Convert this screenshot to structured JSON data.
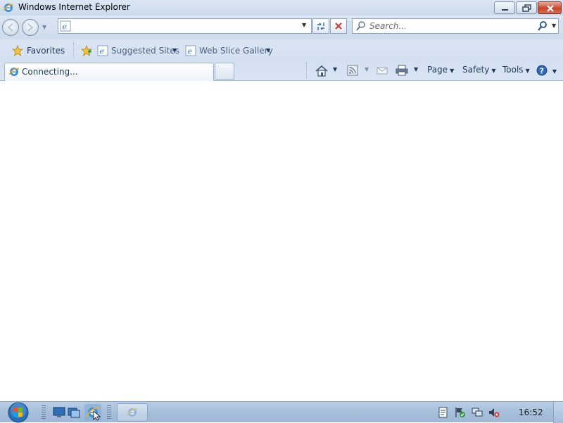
{
  "window": {
    "title": "Windows Internet Explorer",
    "icon": "ie-icon",
    "controls": [
      "minimize-icon",
      "restore-icon",
      "close-icon"
    ]
  },
  "navigation": {
    "address_value": "",
    "search_placeholder": "Search..."
  },
  "favorites_bar": {
    "favorites_label": "Favorites",
    "items": [
      {
        "label": "Suggested Sites",
        "icon": "ie-page-icon"
      },
      {
        "label": "Web Slice Gallery",
        "icon": "ie-page-icon"
      }
    ]
  },
  "tabs": [
    {
      "label": "Connecting...",
      "icon": "ie-icon",
      "active": true
    }
  ],
  "command_bar": {
    "page_label": "Page",
    "safety_label": "Safety",
    "tools_label": "Tools"
  },
  "taskbar": {
    "clock": "16:52"
  },
  "colors": {
    "chrome": "#dbe6f4",
    "accent": "#1e395b",
    "close_red": "#c8452c"
  }
}
